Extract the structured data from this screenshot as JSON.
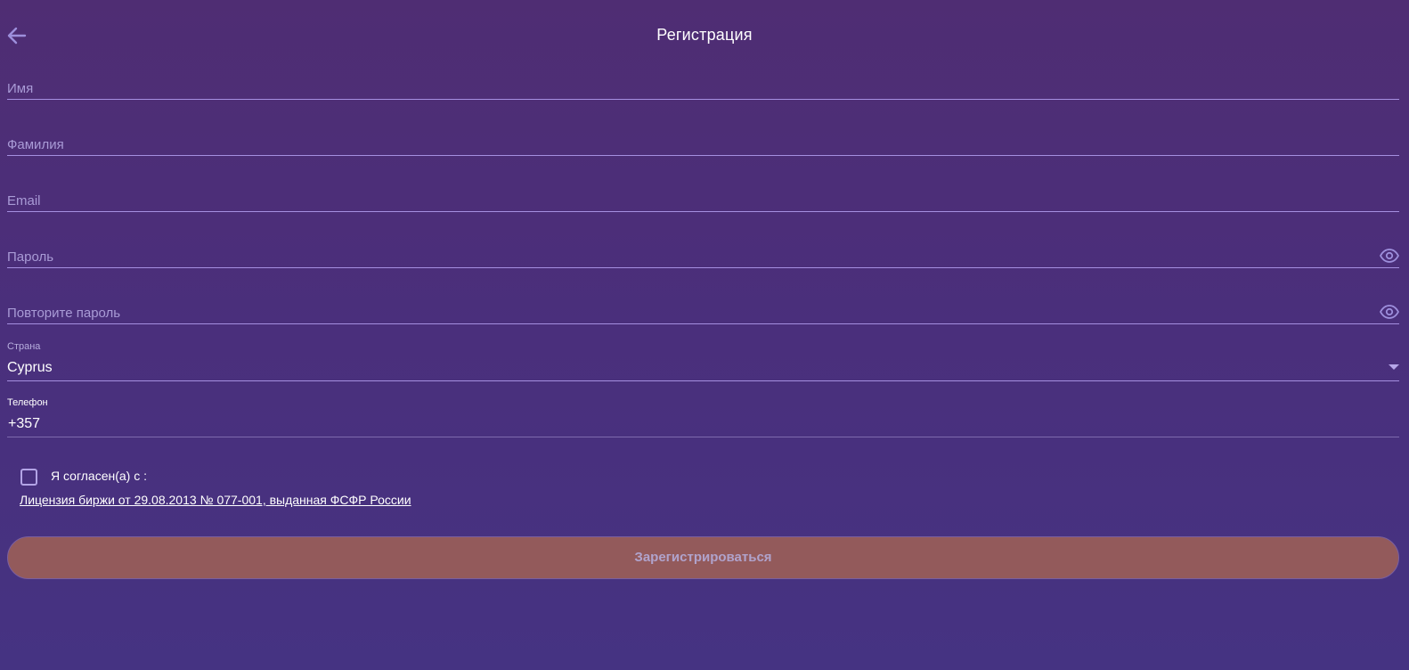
{
  "header": {
    "title": "Регистрация",
    "back_icon": "arrow-left-icon"
  },
  "form": {
    "first_name": {
      "placeholder": "Имя",
      "value": ""
    },
    "last_name": {
      "placeholder": "Фамилия",
      "value": ""
    },
    "email": {
      "placeholder": "Email",
      "value": ""
    },
    "password": {
      "placeholder": "Пароль",
      "value": "",
      "toggle_icon": "eye-icon"
    },
    "password_repeat": {
      "placeholder": "Повторите пароль",
      "value": "",
      "toggle_icon": "eye-icon"
    },
    "country": {
      "label": "Страна",
      "value": "Cyprus",
      "icon": "chevron-down-icon"
    },
    "phone": {
      "label": "Телефон",
      "value": "+357"
    }
  },
  "agreement": {
    "checked": false,
    "text": "Я согласен(а) с :",
    "link": "Лицензия биржи от 29.08.2013 № 077-001, выданная ФСФР России"
  },
  "submit": {
    "label": "Зарегистрироваться",
    "disabled": true
  },
  "colors": {
    "background_top": "#4f2d73",
    "background_bottom": "#453382",
    "accent_line": "#a58fe0",
    "button_bg": "#935a5b",
    "button_text": "#b0a3cc"
  }
}
